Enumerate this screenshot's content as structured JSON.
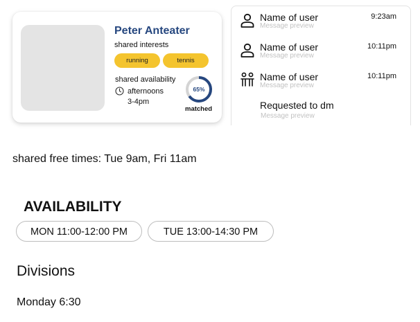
{
  "profile": {
    "name": "Peter Anteater",
    "interests_label": "shared interests",
    "interests": [
      "running",
      "tennis"
    ],
    "availability_label": "shared availability",
    "availability_lines": [
      "afternoons",
      "3-4pm"
    ],
    "match_percent_text": "65%",
    "match_fraction": 0.65,
    "matched_label": "matched",
    "colors": {
      "accent": "#26477f",
      "chip": "#f4c42e",
      "avatar_placeholder": "#e4e4e4"
    }
  },
  "messages": {
    "items": [
      {
        "icon": "user-icon",
        "name": "Name of user",
        "preview": "Message preview",
        "time": "9:23am"
      },
      {
        "icon": "user-icon",
        "name": "Name of user",
        "preview": "Message preview",
        "time": "10:11pm"
      },
      {
        "icon": "group-icon",
        "name": "Name of user",
        "preview": "Message preview",
        "time": "10:11pm"
      }
    ],
    "request": {
      "title": "Requested to dm",
      "preview": "Message preview"
    }
  },
  "shared_free_times": "shared free times: Tue 9am, Fri 11am",
  "availability": {
    "heading": "AVAILABILITY",
    "slots": [
      "MON 11:00-12:00 PM",
      "TUE 13:00-14:30 PM"
    ]
  },
  "divisions": {
    "heading": "Divisions",
    "items": [
      "Monday 6:30"
    ]
  }
}
